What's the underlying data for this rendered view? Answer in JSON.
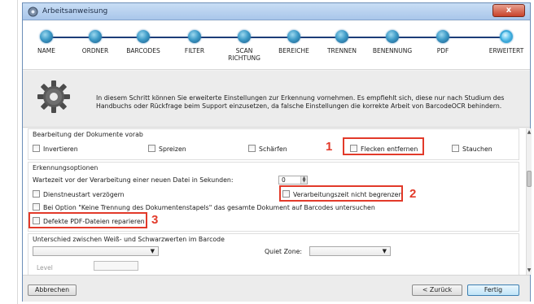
{
  "window": {
    "title": "Arbeitsanweisung",
    "close_glyph": "x"
  },
  "wizard": {
    "steps": [
      {
        "label": "NAME"
      },
      {
        "label": "ORDNER"
      },
      {
        "label": "BARCODES"
      },
      {
        "label": "FILTER"
      },
      {
        "label": "SCAN RICHTUNG",
        "line1": "SCAN",
        "line2": "RICHTUNG"
      },
      {
        "label": "BEREICHE"
      },
      {
        "label": "TRENNEN"
      },
      {
        "label": "BENENNUNG"
      },
      {
        "label": "PDF"
      },
      {
        "label": "ERWEITERT"
      }
    ],
    "active_step": "ERWEITERT"
  },
  "info": {
    "icon": "gear-icon",
    "text": "In diesem Schritt können Sie erweiterte Einstellungen zur Erkennung vornehmen. Es empfiehlt sich, diese nur nach Studium des Handbuchs oder Rückfrage beim Support einzusetzen, da falsche Einstellungen die korrekte Arbeit von BarcodeOCR behindern."
  },
  "sections": {
    "preprocess": {
      "title": "Bearbeitung der Dokumente vorab",
      "options": {
        "invert": "Invertieren",
        "spread": "Spreizen",
        "sharpen": "Schärfen",
        "despeckle": "Flecken entfernen",
        "compress": "Stauchen"
      }
    },
    "recognition": {
      "title": "Erkennungsoptionen",
      "wait_label": "Wartezeit vor der Verarbeitung einer neuen Datei in Sekunden:",
      "wait_value": "0",
      "delay_restart": "Dienstneustart verzögern",
      "unlimited_time": "Verarbeitungszeit nicht begrenzen",
      "search_whole": "Bei Option \"Keine Trennung des Dokumentenstapels\" das gesamte Dokument auf Barcodes untersuchen",
      "repair_pdf": "Defekte PDF-Dateien reparieren"
    },
    "contrast": {
      "title": "Unterschied zwischen Weiß- und Schwarzwerten im Barcode",
      "quiet_zone_label": "Quiet Zone:",
      "level_label": "Level"
    }
  },
  "annotations": {
    "n1": "1",
    "n2": "2",
    "n3": "3",
    "color": "#e23a2a"
  },
  "footer": {
    "cancel": "Abbrechen",
    "back": "< Zurück",
    "finish": "Fertig"
  }
}
